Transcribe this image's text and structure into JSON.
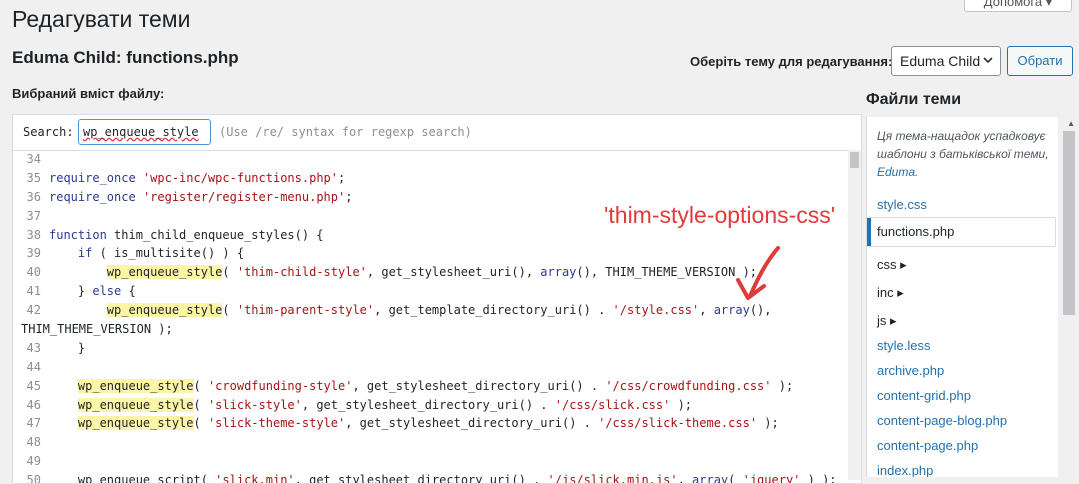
{
  "header": {
    "help_button": "Допомога ▾",
    "page_title": "Редагувати теми",
    "file_title": "Eduma Child: functions.php",
    "content_label": "Вибраний вміст файлу:",
    "theme_select_label": "Оберіть тему для редагування:",
    "theme_select_value": "Eduma Child",
    "select_button": "Обрати"
  },
  "search": {
    "label": "Search:",
    "value": "wp_enqueue_style",
    "hint": "(Use /re/ syntax for regexp search)"
  },
  "code_lines": [
    {
      "n": "34",
      "html": ""
    },
    {
      "n": "35",
      "html": "<span class='kw'>require_once</span> <span class='str'>'wpc-inc/wpc-functions.php'</span>;"
    },
    {
      "n": "36",
      "html": "<span class='kw'>require_once</span> <span class='str'>'register/register-menu.php'</span>;"
    },
    {
      "n": "37",
      "html": ""
    },
    {
      "n": "38",
      "html": "<span class='kw'>function</span> thim_child_enqueue_styles() {"
    },
    {
      "n": "39",
      "html": "    <span class='kw'>if</span> ( is_multisite() ) {"
    },
    {
      "n": "40",
      "html": "        <span class='hl'>wp_enqueue_style</span>( <span class='str'>'thim-child-style'</span>, get_stylesheet_uri(), <span class='kw'>array</span>(), THIM_THEME_VERSION );"
    },
    {
      "n": "41",
      "html": "    } <span class='kw'>else</span> {"
    },
    {
      "n": "42",
      "html": "        <span class='hl'>wp_enqueue_style</span>( <span class='str'>'thim-parent-style'</span>, get_template_directory_uri() . <span class='str'>'/style.css'</span>, <span class='kw'>array</span>(),"
    },
    {
      "n": "",
      "html": "THIM_THEME_VERSION );"
    },
    {
      "n": "43",
      "html": "    }"
    },
    {
      "n": "44",
      "html": ""
    },
    {
      "n": "45",
      "html": "    <span class='hl'>wp_enqueue_style</span>( <span class='str'>'crowdfunding-style'</span>, get_stylesheet_directory_uri() . <span class='str'>'/css/crowdfunding.css'</span> );"
    },
    {
      "n": "46",
      "html": "    <span class='hl'>wp_enqueue_style</span>( <span class='str'>'slick-style'</span>, get_stylesheet_directory_uri() . <span class='str'>'/css/slick.css'</span> );"
    },
    {
      "n": "47",
      "html": "    <span class='hl'>wp_enqueue_style</span>( <span class='str'>'slick-theme-style'</span>, get_stylesheet_directory_uri() . <span class='str'>'/css/slick-theme.css'</span> );"
    },
    {
      "n": "48",
      "html": ""
    },
    {
      "n": "49",
      "html": ""
    },
    {
      "n": "50",
      "html": "    wp_enqueue_script( <span class='str'>'slick.min'</span>, get_stylesheet_directory_uri() . <span class='str'>'/js/slick.min.js'</span>, <span class='kw'>array</span>( <span class='str'>'jquery'</span> ) );"
    }
  ],
  "annotation": "'thim-style-options-css'",
  "files": {
    "heading": "Файли теми",
    "child_note": "Ця тема-нащадок успадковує шаблони з батьківської теми, ",
    "parent_link": "Eduma",
    "items": [
      {
        "label": "style.css",
        "kind": "file"
      },
      {
        "label": "functions.php",
        "kind": "active"
      },
      {
        "label": "css ▸",
        "kind": "dir"
      },
      {
        "label": "inc ▸",
        "kind": "dir"
      },
      {
        "label": "js ▸",
        "kind": "dir"
      },
      {
        "label": "style.less",
        "kind": "file"
      },
      {
        "label": "archive.php",
        "kind": "file"
      },
      {
        "label": "content-grid.php",
        "kind": "file"
      },
      {
        "label": "content-page-blog.php",
        "kind": "file"
      },
      {
        "label": "content-page.php",
        "kind": "file"
      },
      {
        "label": "index.php",
        "kind": "file"
      }
    ]
  },
  "colors": {
    "accent": "#2271b1",
    "highlight": "#fcf5a7",
    "annotation": "#e03a3a"
  }
}
